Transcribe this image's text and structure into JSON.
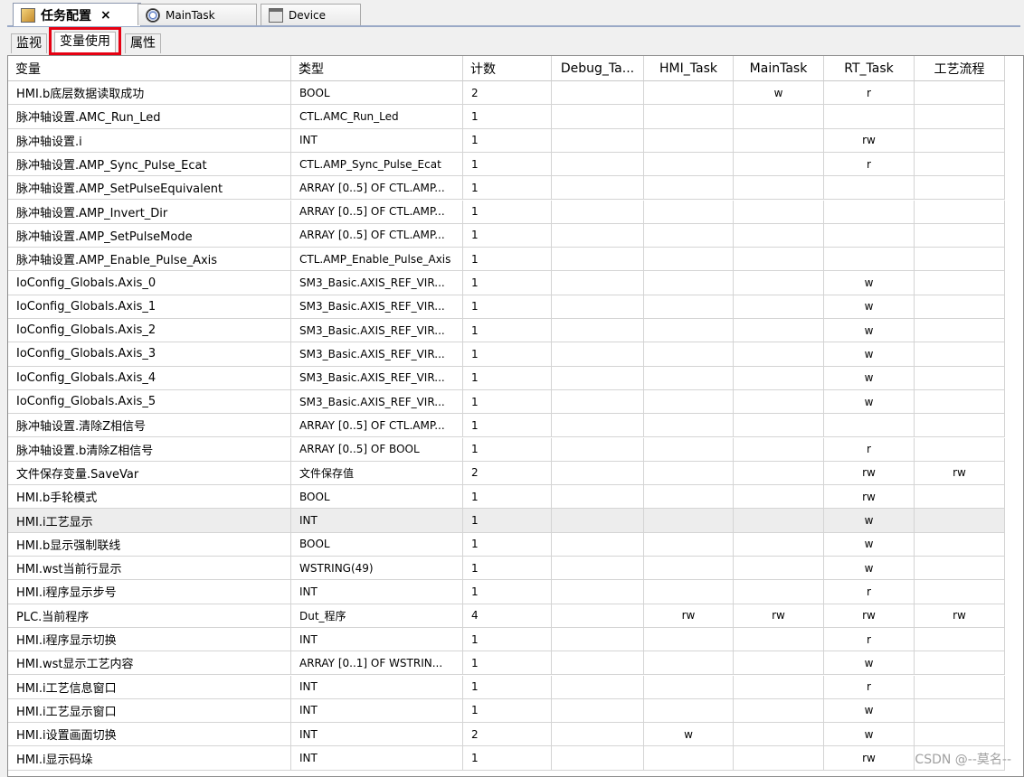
{
  "editor_tabs": [
    {
      "label": "任务配置",
      "close": "×",
      "icon": "task-config-icon"
    },
    {
      "label": "MainTask",
      "icon": "task-icon"
    },
    {
      "label": "Device",
      "icon": "device-icon"
    }
  ],
  "sub_tabs": [
    {
      "label": "监视"
    },
    {
      "label": "变量使用"
    },
    {
      "label": "属性"
    }
  ],
  "table": {
    "columns": [
      "变量",
      "类型",
      "计数",
      "Debug_Ta...",
      "HMI_Task",
      "MainTask",
      "RT_Task",
      "工艺流程"
    ],
    "rows": [
      [
        "HMI.b底层数据读取成功",
        "BOOL",
        "2",
        "",
        "",
        "w",
        "r",
        ""
      ],
      [
        "脉冲轴设置.AMC_Run_Led",
        "CTL.AMC_Run_Led",
        "1",
        "",
        "",
        "",
        "",
        ""
      ],
      [
        "脉冲轴设置.i",
        "INT",
        "1",
        "",
        "",
        "",
        "rw",
        ""
      ],
      [
        "脉冲轴设置.AMP_Sync_Pulse_Ecat",
        "CTL.AMP_Sync_Pulse_Ecat",
        "1",
        "",
        "",
        "",
        "r",
        ""
      ],
      [
        "脉冲轴设置.AMP_SetPulseEquivalent",
        "ARRAY [0..5] OF CTL.AMP...",
        "1",
        "",
        "",
        "",
        "",
        ""
      ],
      [
        "脉冲轴设置.AMP_Invert_Dir",
        "ARRAY [0..5] OF CTL.AMP...",
        "1",
        "",
        "",
        "",
        "",
        ""
      ],
      [
        "脉冲轴设置.AMP_SetPulseMode",
        "ARRAY [0..5] OF CTL.AMP...",
        "1",
        "",
        "",
        "",
        "",
        ""
      ],
      [
        "脉冲轴设置.AMP_Enable_Pulse_Axis",
        "CTL.AMP_Enable_Pulse_Axis",
        "1",
        "",
        "",
        "",
        "",
        ""
      ],
      [
        "IoConfig_Globals.Axis_0",
        "SM3_Basic.AXIS_REF_VIR...",
        "1",
        "",
        "",
        "",
        "w",
        ""
      ],
      [
        "IoConfig_Globals.Axis_1",
        "SM3_Basic.AXIS_REF_VIR...",
        "1",
        "",
        "",
        "",
        "w",
        ""
      ],
      [
        "IoConfig_Globals.Axis_2",
        "SM3_Basic.AXIS_REF_VIR...",
        "1",
        "",
        "",
        "",
        "w",
        ""
      ],
      [
        "IoConfig_Globals.Axis_3",
        "SM3_Basic.AXIS_REF_VIR...",
        "1",
        "",
        "",
        "",
        "w",
        ""
      ],
      [
        "IoConfig_Globals.Axis_4",
        "SM3_Basic.AXIS_REF_VIR...",
        "1",
        "",
        "",
        "",
        "w",
        ""
      ],
      [
        "IoConfig_Globals.Axis_5",
        "SM3_Basic.AXIS_REF_VIR...",
        "1",
        "",
        "",
        "",
        "w",
        ""
      ],
      [
        "脉冲轴设置.清除Z相信号",
        "ARRAY [0..5] OF CTL.AMP...",
        "1",
        "",
        "",
        "",
        "",
        ""
      ],
      [
        "脉冲轴设置.b清除Z相信号",
        "ARRAY [0..5] OF BOOL",
        "1",
        "",
        "",
        "",
        "r",
        ""
      ],
      [
        "文件保存变量.SaveVar",
        "文件保存值",
        "2",
        "",
        "",
        "",
        "rw",
        "rw"
      ],
      [
        "HMI.b手轮模式",
        "BOOL",
        "1",
        "",
        "",
        "",
        "rw",
        ""
      ],
      [
        "HMI.i工艺显示",
        "INT",
        "1",
        "",
        "",
        "",
        "w",
        ""
      ],
      [
        "HMI.b显示强制联线",
        "BOOL",
        "1",
        "",
        "",
        "",
        "w",
        ""
      ],
      [
        "HMI.wst当前行显示",
        "WSTRING(49)",
        "1",
        "",
        "",
        "",
        "w",
        ""
      ],
      [
        "HMI.i程序显示步号",
        "INT",
        "1",
        "",
        "",
        "",
        "r",
        ""
      ],
      [
        "PLC.当前程序",
        "Dut_程序",
        "4",
        "",
        "rw",
        "rw",
        "rw",
        "rw"
      ],
      [
        "HMI.i程序显示切换",
        "INT",
        "1",
        "",
        "",
        "",
        "r",
        ""
      ],
      [
        "HMI.wst显示工艺内容",
        "ARRAY [0..1] OF WSTRIN...",
        "1",
        "",
        "",
        "",
        "w",
        ""
      ],
      [
        "HMI.i工艺信息窗口",
        "INT",
        "1",
        "",
        "",
        "",
        "r",
        ""
      ],
      [
        "HMI.i工艺显示窗口",
        "INT",
        "1",
        "",
        "",
        "",
        "w",
        ""
      ],
      [
        "HMI.i设置画面切换",
        "INT",
        "2",
        "",
        "w",
        "",
        "w",
        ""
      ],
      [
        "HMI.i显示码垛",
        "INT",
        "1",
        "",
        "",
        "",
        "rw",
        ""
      ]
    ],
    "selected_row": 18
  },
  "watermark": "CSDN @--莫名--",
  "colors": {
    "highlight": "#e60012",
    "selected_row": "#ededed"
  }
}
